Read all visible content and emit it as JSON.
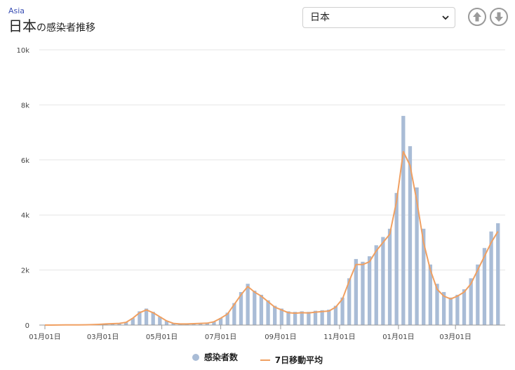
{
  "header": {
    "breadcrumb": "Asia",
    "title_main": "日本",
    "title_sub": "の感染者推移"
  },
  "region_select": {
    "selected": "日本"
  },
  "icons": {
    "up": "arrow-up-circle-icon",
    "down": "arrow-down-circle-icon",
    "select": "chevron-down-icon"
  },
  "colors": {
    "bar": "#a9bcd6",
    "line": "#f0a062",
    "grid": "#e6e6e6"
  },
  "legend": {
    "bars_label": "感染者数",
    "line_label": "7日移動平均"
  },
  "chart_data": {
    "type": "bar",
    "title": "",
    "xlabel": "",
    "ylabel": "",
    "ylim": [
      0,
      10000
    ],
    "y_ticks": [
      "0",
      "2k",
      "4k",
      "6k",
      "8k",
      "10k"
    ],
    "x_ticks": [
      "01月01日",
      "03月01日",
      "05月01日",
      "07月01日",
      "09月01日",
      "11月01日",
      "01月01日",
      "03月01日"
    ],
    "grid": true,
    "legend_position": "bottom",
    "weeks": [
      "2020-01-01",
      "2020-01-08",
      "2020-01-15",
      "2020-01-22",
      "2020-01-29",
      "2020-02-05",
      "2020-02-12",
      "2020-02-19",
      "2020-02-26",
      "2020-03-04",
      "2020-03-11",
      "2020-03-18",
      "2020-03-25",
      "2020-04-01",
      "2020-04-08",
      "2020-04-15",
      "2020-04-22",
      "2020-04-29",
      "2020-05-06",
      "2020-05-13",
      "2020-05-20",
      "2020-05-27",
      "2020-06-03",
      "2020-06-10",
      "2020-06-17",
      "2020-06-24",
      "2020-07-01",
      "2020-07-08",
      "2020-07-15",
      "2020-07-22",
      "2020-07-29",
      "2020-08-05",
      "2020-08-12",
      "2020-08-19",
      "2020-08-26",
      "2020-09-02",
      "2020-09-09",
      "2020-09-16",
      "2020-09-23",
      "2020-09-30",
      "2020-10-07",
      "2020-10-14",
      "2020-10-21",
      "2020-10-28",
      "2020-11-04",
      "2020-11-11",
      "2020-11-18",
      "2020-11-25",
      "2020-12-02",
      "2020-12-09",
      "2020-12-16",
      "2020-12-23",
      "2020-12-30",
      "2021-01-06",
      "2021-01-13",
      "2021-01-20",
      "2021-01-27",
      "2021-02-03",
      "2021-02-10",
      "2021-02-17",
      "2021-02-24",
      "2021-03-03",
      "2021-03-10",
      "2021-03-17",
      "2021-03-24",
      "2021-03-31",
      "2021-04-07",
      "2021-04-14"
    ],
    "series": [
      {
        "name": "感染者数",
        "values": [
          0,
          0,
          2,
          5,
          8,
          5,
          10,
          15,
          25,
          40,
          50,
          60,
          100,
          250,
          500,
          600,
          480,
          300,
          150,
          60,
          40,
          40,
          50,
          60,
          70,
          120,
          250,
          450,
          800,
          1200,
          1500,
          1250,
          1100,
          900,
          700,
          600,
          500,
          480,
          500,
          480,
          520,
          540,
          560,
          700,
          1000,
          1700,
          2400,
          2300,
          2500,
          2900,
          3200,
          3500,
          4800,
          7600,
          6500,
          5000,
          3500,
          2200,
          1500,
          1200,
          1000,
          1100,
          1300,
          1700,
          2200,
          2800,
          3400,
          3700
        ]
      },
      {
        "name": "7日移動平均",
        "values": [
          0,
          0,
          2,
          5,
          8,
          5,
          10,
          15,
          25,
          40,
          50,
          60,
          100,
          250,
          450,
          550,
          450,
          300,
          150,
          60,
          40,
          40,
          50,
          60,
          70,
          120,
          250,
          400,
          750,
          1100,
          1400,
          1200,
          1050,
          850,
          650,
          550,
          450,
          430,
          450,
          440,
          470,
          490,
          510,
          650,
          950,
          1600,
          2200,
          2200,
          2300,
          2700,
          3000,
          3300,
          4500,
          6300,
          5800,
          4500,
          3000,
          2000,
          1300,
          1050,
          950,
          1050,
          1200,
          1500,
          2000,
          2500,
          3000,
          3400
        ]
      }
    ]
  }
}
